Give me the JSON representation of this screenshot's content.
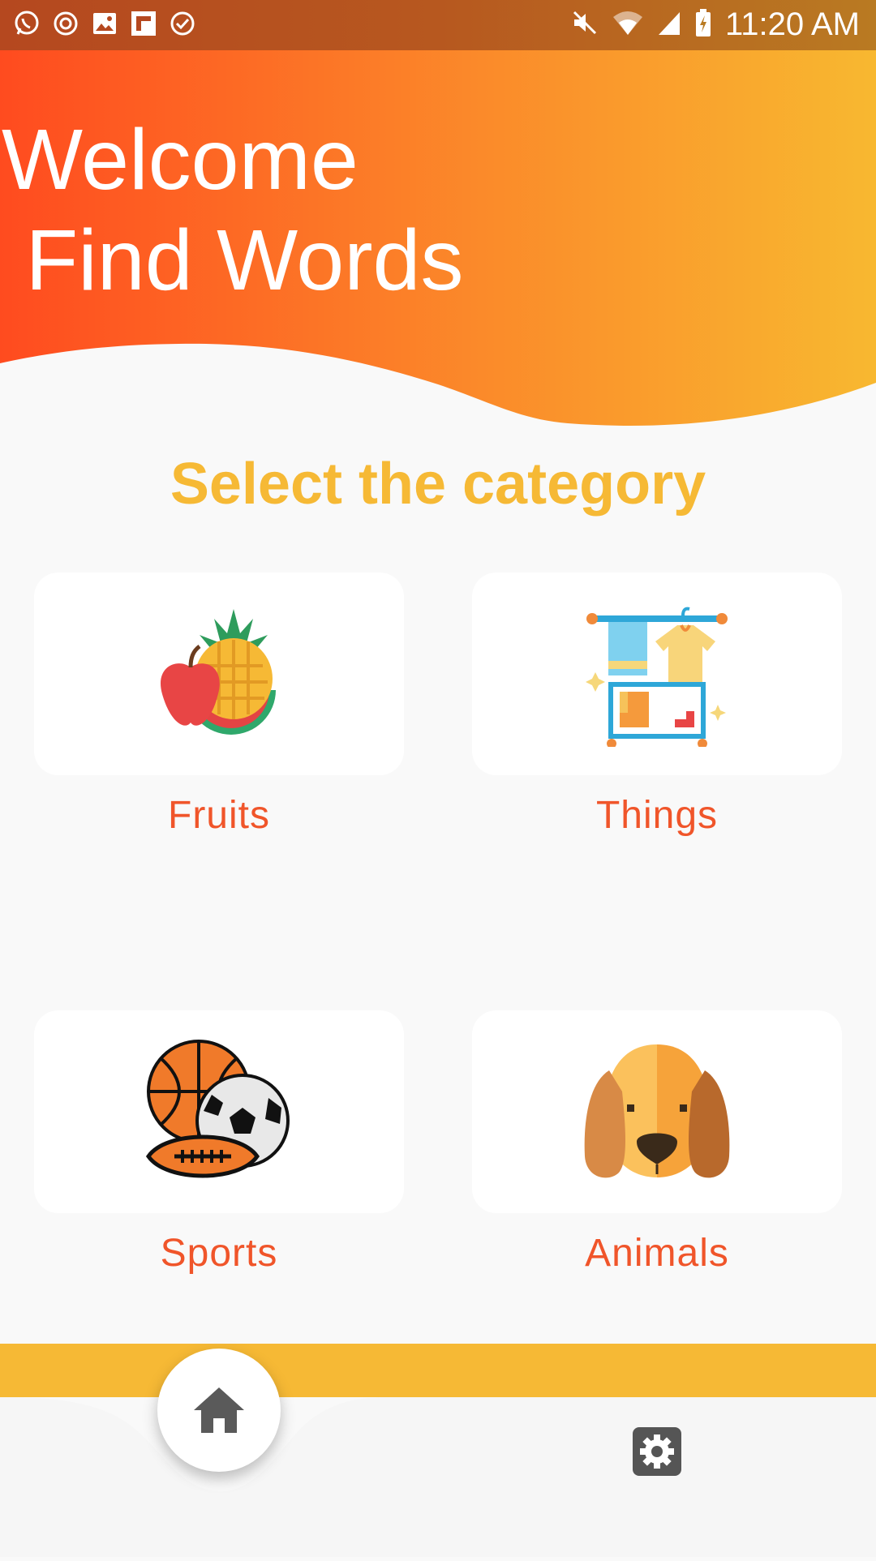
{
  "status_bar": {
    "time": "11:20 AM",
    "left_icons": [
      "whatsapp-icon",
      "sync-icon",
      "image-icon",
      "flipboard-icon",
      "check-circle-icon"
    ],
    "right_icons": [
      "mute-icon",
      "wifi-icon",
      "signal-icon",
      "battery-charging-icon"
    ]
  },
  "header": {
    "title": "Welcome\n Find Words",
    "gradient_colors": [
      "#ff4b1f",
      "#f8b830"
    ]
  },
  "main": {
    "section_title": "Select the category",
    "categories": [
      {
        "label": "Fruits",
        "icon": "fruits-icon"
      },
      {
        "label": "Things",
        "icon": "clothes-rack-icon"
      },
      {
        "label": "Sports",
        "icon": "sports-balls-icon"
      },
      {
        "label": "Animals",
        "icon": "dog-icon"
      }
    ]
  },
  "bottom_nav": {
    "items": [
      {
        "icon": "home-icon",
        "selected": true
      },
      {
        "icon": "settings-icon",
        "selected": false
      }
    ],
    "accent_color": "#f6b935"
  },
  "colors": {
    "accent": "#f6b935",
    "label": "#f0552a",
    "background": "#f9f9f9"
  }
}
